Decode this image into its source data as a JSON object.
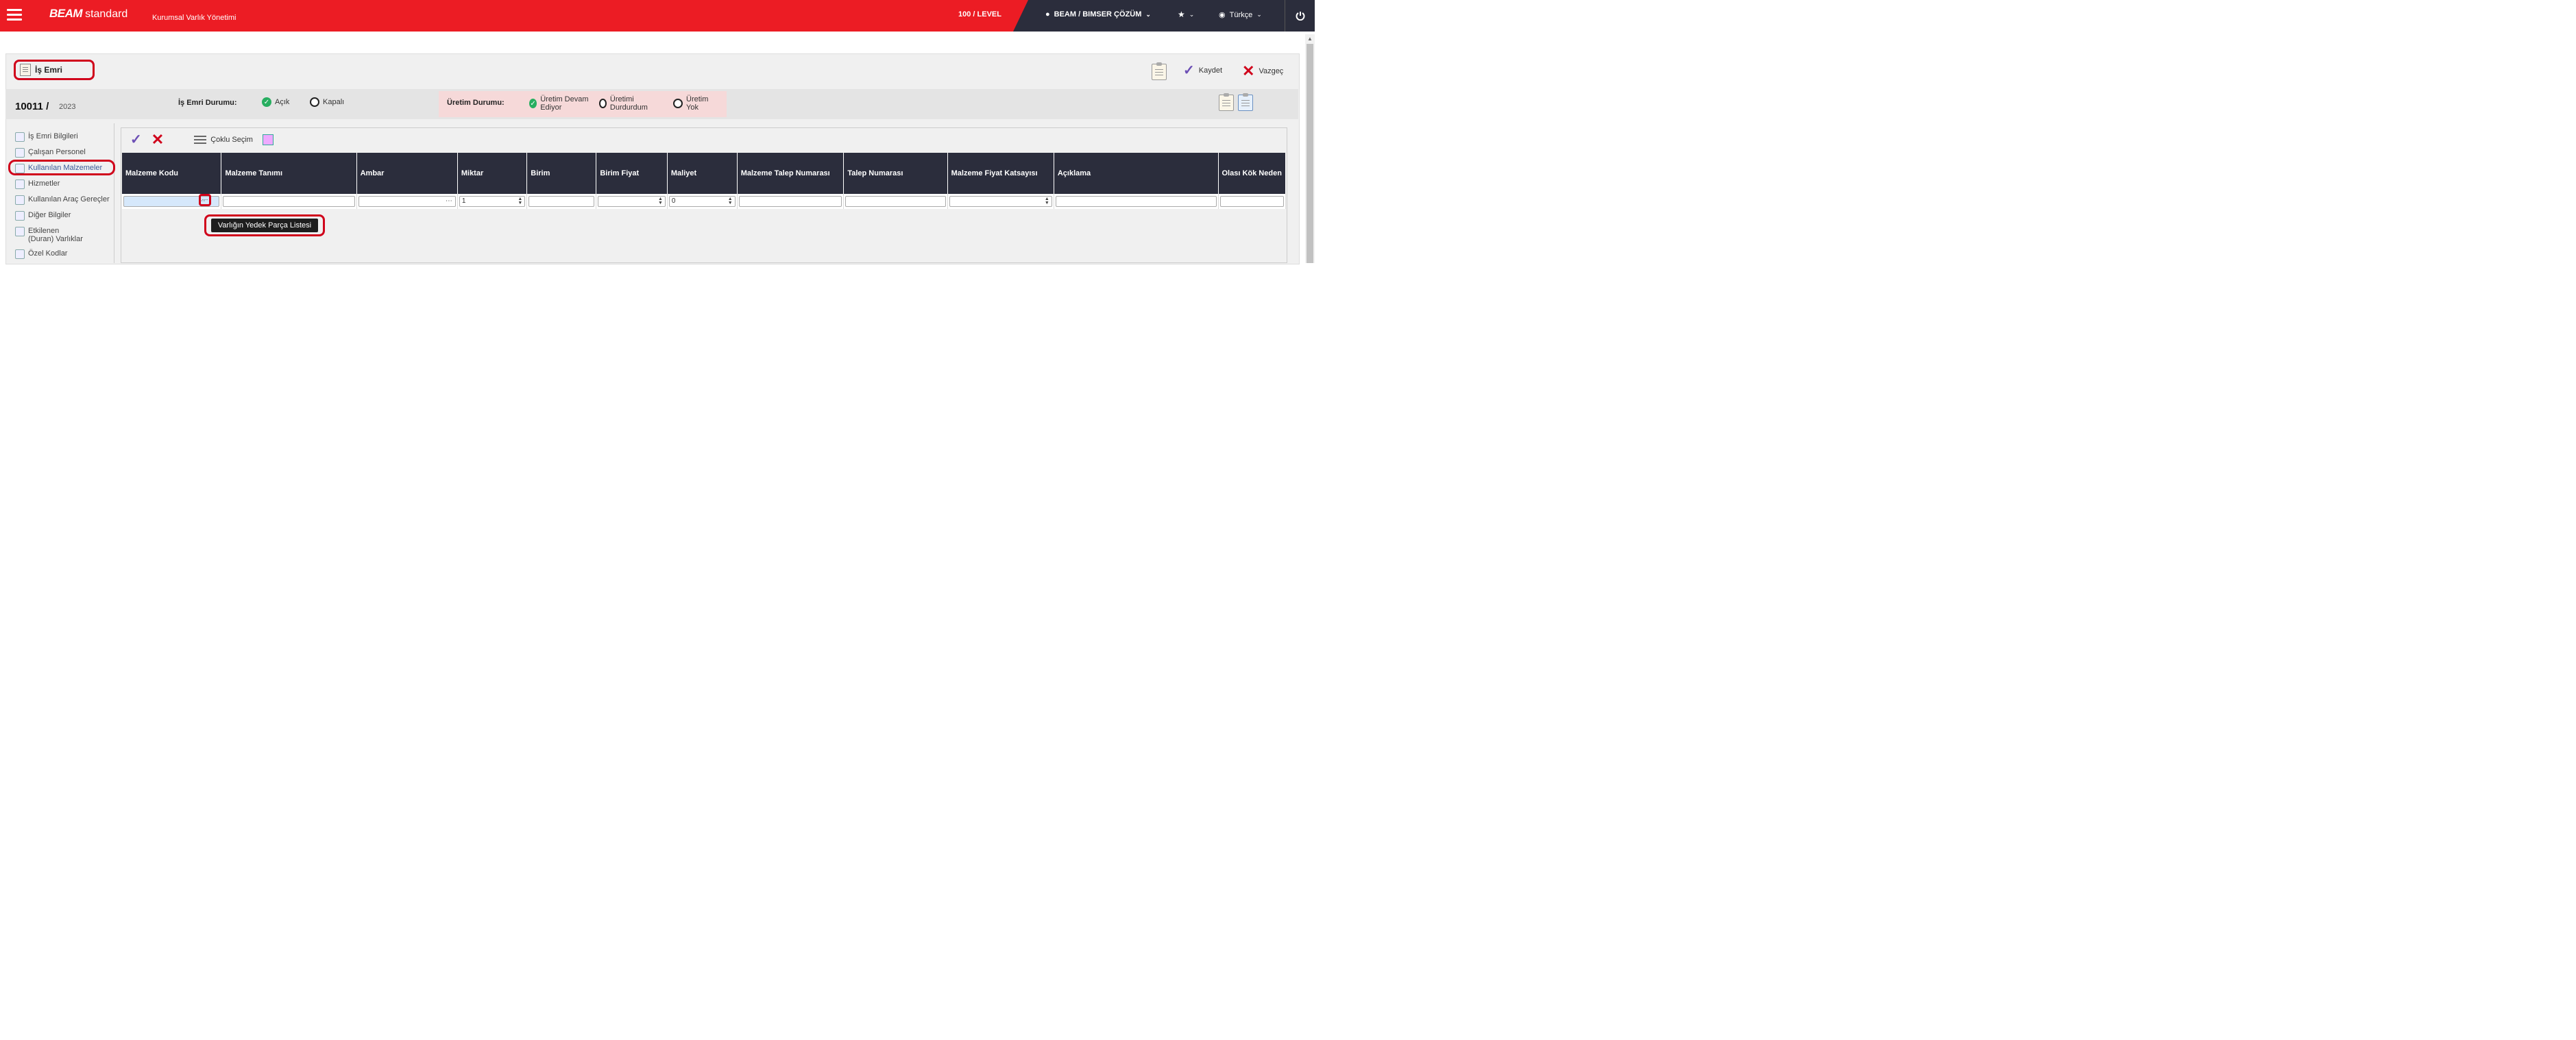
{
  "app": {
    "brand": "BEAM",
    "edition": "standard",
    "subtitle": "Kurumsal Varlık Yönetimi",
    "level": "100 / LEVEL",
    "user": "BEAM / BIMSER ÇÖZÜM",
    "language": "Türkçe"
  },
  "form": {
    "title": "İş Emri",
    "save_label": "Kaydet",
    "cancel_label": "Vazgeç",
    "work_order_number": "10011",
    "separator": "/",
    "year": "2023",
    "status_label": "İş Emri Durumu:",
    "status_open": "Açık",
    "status_closed": "Kapalı",
    "production_label": "Üretim Durumu:",
    "production_running": "Üretim Devam Ediyor",
    "production_stopped": "Üretimi Durdurdum",
    "production_none": "Üretim Yok"
  },
  "sidebar": {
    "items": [
      {
        "label": "İş Emri Bilgileri"
      },
      {
        "label": "Çalışan Personel"
      },
      {
        "label": "Kullanılan Malzemeler"
      },
      {
        "label": "Hizmetler"
      },
      {
        "label": "Kullanılan Araç Gereçler"
      },
      {
        "label": "Diğer Bilgiler"
      },
      {
        "label": "Etkilenen (Duran) Varlıklar"
      },
      {
        "label": "Özel Kodlar"
      }
    ]
  },
  "grid": {
    "multi_select_label": "Çoklu Seçim",
    "columns": [
      "Malzeme Kodu",
      "Malzeme Tanımı",
      "Ambar",
      "Miktar",
      "Birim",
      "Birim Fiyat",
      "Maliyet",
      "Malzeme Talep Numarası",
      "Talep Numarası",
      "Malzeme Fiyat Katsayısı",
      "Açıklama",
      "Olası Kök Neden"
    ],
    "row": {
      "quantity": "1",
      "cost": "0"
    },
    "tooltip": "Varlığın Yedek Parça Listesi"
  },
  "colors": {
    "brand_red": "#ec1c24",
    "dark": "#2b2d3c",
    "highlight": "#d0021b",
    "accent_green": "#27ae60"
  }
}
